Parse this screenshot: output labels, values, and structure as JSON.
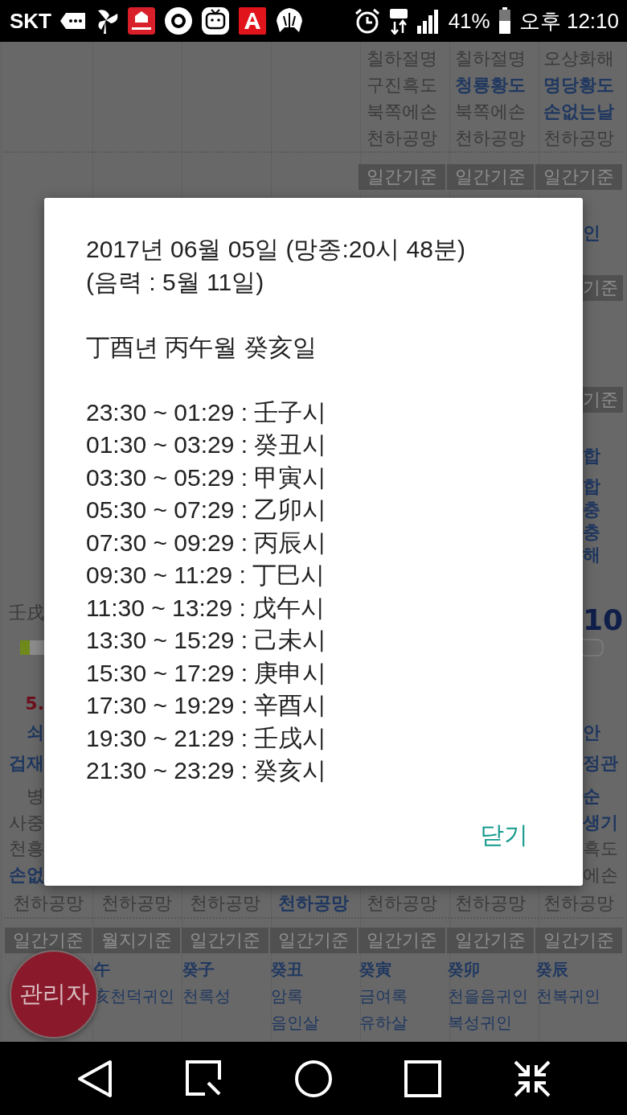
{
  "status_bar": {
    "carrier": "SKT",
    "battery": "41%",
    "time": "오후 12:10"
  },
  "background": {
    "top_rows": [
      [
        {
          "text": "칠하절명",
          "kind": "muted"
        },
        {
          "text": "칠하절명",
          "kind": "muted"
        },
        {
          "text": "오상화해",
          "kind": "muted"
        }
      ],
      [
        {
          "text": "구진흑도",
          "kind": "muted"
        },
        {
          "text": "청룡황도",
          "kind": "accent"
        },
        {
          "text": "명당황도",
          "kind": "accent"
        }
      ],
      [
        {
          "text": "북쪽에손",
          "kind": "muted"
        },
        {
          "text": "북쪽에손",
          "kind": "muted"
        },
        {
          "text": "손없는날",
          "kind": "accent"
        }
      ],
      [
        {
          "text": "천하공망",
          "kind": "muted"
        },
        {
          "text": "천하공망",
          "kind": "muted"
        },
        {
          "text": "천하공망",
          "kind": "muted"
        }
      ]
    ],
    "top_headers": [
      "일간기준",
      "일간기준",
      "일간기준"
    ],
    "left_fragments": [
      {
        "kind": "plain",
        "text": "壬戌"
      },
      {
        "kind": "meter"
      },
      {
        "kind": "warning",
        "text": "5."
      },
      {
        "kind": "accent",
        "text": "쇠"
      },
      {
        "kind": "accent",
        "text": "겁재"
      },
      {
        "kind": "muted",
        "text": "병"
      },
      {
        "kind": "muted",
        "text": "사중"
      },
      {
        "kind": "muted",
        "text": "천흥"
      },
      {
        "kind": "accent",
        "text": "손없"
      }
    ],
    "right_fragments": [
      {
        "kind": "accent",
        "text": "인"
      },
      {
        "kind": "header",
        "text": "기준"
      },
      {
        "kind": "header",
        "text": "기준"
      },
      {
        "kind": "accent",
        "text": "합"
      },
      {
        "kind": "accent",
        "text": "합"
      },
      {
        "kind": "accent",
        "text": "충"
      },
      {
        "kind": "accent",
        "text": "충"
      },
      {
        "kind": "accent",
        "text": "해"
      },
      {
        "kind": "number",
        "text": "10"
      },
      {
        "kind": "meter"
      },
      {
        "kind": "accent",
        "text": "안"
      },
      {
        "kind": "accent",
        "text": "정관"
      },
      {
        "kind": "accent",
        "text": "순"
      },
      {
        "kind": "accent",
        "text": "생기"
      },
      {
        "kind": "muted",
        "text": "흑도"
      },
      {
        "kind": "muted",
        "text": "에손"
      }
    ],
    "bottom_row": [
      {
        "text": "천하공망",
        "kind": "muted"
      },
      {
        "text": "천하공망",
        "kind": "muted"
      },
      {
        "text": "천하공망",
        "kind": "muted"
      },
      {
        "text": "천하공망",
        "kind": "accent"
      },
      {
        "text": "천하공망",
        "kind": "muted"
      },
      {
        "text": "천하공망",
        "kind": "muted"
      },
      {
        "text": "천하공망",
        "kind": "muted"
      }
    ],
    "bottom_headers": [
      "일간기준",
      "월지기준",
      "일간기준",
      "일간기준",
      "일간기준",
      "일간기준",
      "일간기준"
    ],
    "bottom_cells": [
      [
        "午",
        "亥천덕귀인"
      ],
      [
        "癸子",
        "천록성"
      ],
      [
        "癸丑",
        "암록",
        "음인살"
      ],
      [
        "癸寅",
        "금여록",
        "유하살"
      ],
      [
        "癸卯",
        "천을음귀인",
        "복성귀인"
      ],
      [
        "癸辰",
        "천복귀인"
      ]
    ]
  },
  "dialog": {
    "date_line": "2017년 06월 05일 (망종:20시 48분)",
    "lunar_line": "(음력 : 5월 11일)",
    "ganji_line": "丁酉년 丙午월 癸亥일",
    "hours": [
      "23:30 ~ 01:29 : 壬子시",
      "01:30 ~ 03:29 : 癸丑시",
      "03:30 ~ 05:29 : 甲寅시",
      "05:30 ~ 07:29 : 乙卯시",
      "07:30 ~ 09:29 : 丙辰시",
      "09:30 ~ 11:29 : 丁巳시",
      "11:30 ~ 13:29 : 戊午시",
      "13:30 ~ 15:29 : 己未시",
      "15:30 ~ 17:29 : 庚申시",
      "17:30 ~ 19:29 : 辛酉시",
      "19:30 ~ 21:29 : 壬戌시",
      "21:30 ~ 23:29 : 癸亥시"
    ],
    "close_button": "닫기"
  },
  "fab": {
    "label": "관리자"
  }
}
